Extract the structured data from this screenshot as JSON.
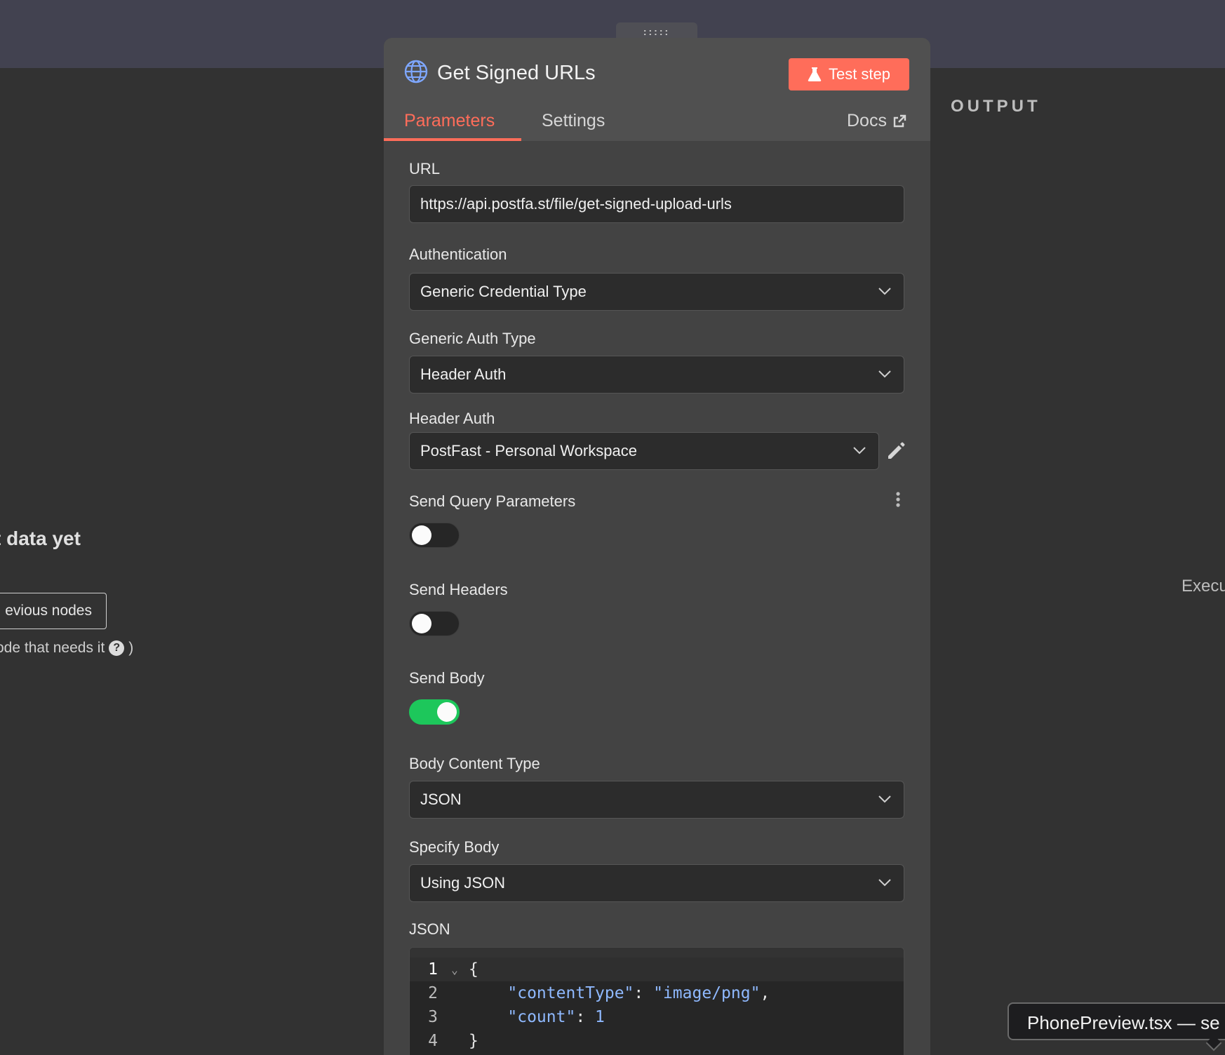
{
  "left": {
    "empty_title": "t data yet",
    "prev_button": "evious nodes",
    "hint_text": "ode that needs it",
    "hint_close": ")"
  },
  "right": {
    "output_label": "OUTPUT",
    "exec_text": "Execu"
  },
  "tooltip": {
    "text": "PhonePreview.tsx — se"
  },
  "handle": {
    "glyph": ":::::"
  },
  "node": {
    "title": "Get Signed URLs",
    "icon": "globe-icon",
    "test_button": "Test step",
    "tabs": [
      {
        "label": "Parameters",
        "active": true
      },
      {
        "label": "Settings",
        "active": false
      }
    ],
    "docs_label": "Docs"
  },
  "params": {
    "url_label": "URL",
    "url_value": "https://api.postfa.st/file/get-signed-upload-urls",
    "auth_label": "Authentication",
    "auth_value": "Generic Credential Type",
    "gen_auth_label": "Generic Auth Type",
    "gen_auth_value": "Header Auth",
    "header_auth_label": "Header Auth",
    "header_auth_value": "PostFast - Personal Workspace",
    "send_query_label": "Send Query Parameters",
    "send_query_on": false,
    "send_headers_label": "Send Headers",
    "send_headers_on": false,
    "send_body_label": "Send Body",
    "send_body_on": true,
    "body_type_label": "Body Content Type",
    "body_type_value": "JSON",
    "specify_body_label": "Specify Body",
    "specify_body_value": "Using JSON",
    "json_label": "JSON"
  },
  "editor": {
    "lines": [
      {
        "num": "1",
        "fold": "⌄",
        "open": "{"
      },
      {
        "num": "2",
        "key": "\"contentType\"",
        "sep": ": ",
        "val": "\"image/png\"",
        "end": ","
      },
      {
        "num": "3",
        "key": "\"count\"",
        "sep": ": ",
        "val": "1",
        "end": ""
      },
      {
        "num": "4",
        "close": "}"
      }
    ]
  },
  "colors": {
    "accent": "#ff6d5a",
    "toggle_on": "#1dc75b",
    "code_value": "#8fb9ff"
  }
}
